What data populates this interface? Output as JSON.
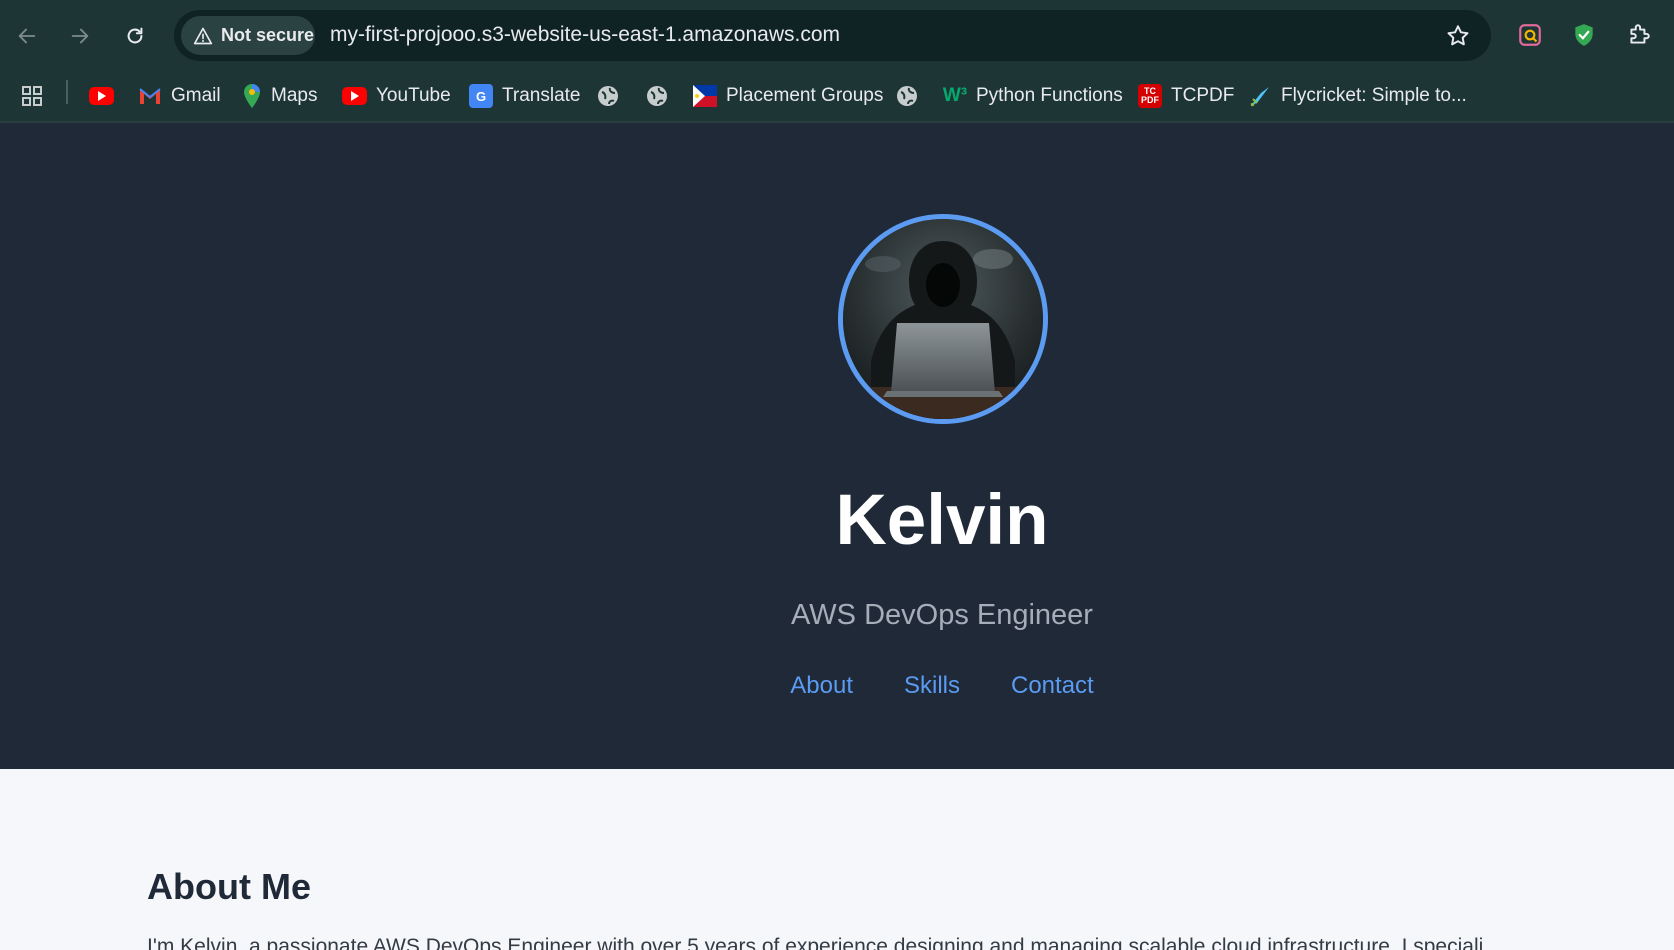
{
  "browser": {
    "security_label": "Not secure",
    "url": "my-first-projooo.s3-website-us-east-1.amazonaws.com",
    "bookmarks": [
      {
        "label": "",
        "icon": "youtube-icon"
      },
      {
        "label": "Gmail",
        "icon": "gmail-icon"
      },
      {
        "label": "Maps",
        "icon": "maps-icon"
      },
      {
        "label": "YouTube",
        "icon": "youtube-icon"
      },
      {
        "label": "Translate",
        "icon": "translate-icon"
      },
      {
        "label": "",
        "icon": "globe-icon"
      },
      {
        "label": "",
        "icon": "globe-icon"
      },
      {
        "label": "Placement Groups",
        "icon": "flag-icon"
      },
      {
        "label": "",
        "icon": "globe-icon"
      },
      {
        "label": "Python Functions",
        "icon": "w3schools-icon"
      },
      {
        "label": "TCPDF",
        "icon": "tcpdf-icon"
      },
      {
        "label": "Flycricket: Simple to...",
        "icon": "flycricket-icon"
      }
    ]
  },
  "profile": {
    "name": "Kelvin",
    "role": "AWS DevOps Engineer",
    "nav": [
      "About",
      "Skills",
      "Contact"
    ]
  },
  "about": {
    "heading": "About Me",
    "text": "I'm Kelvin, a passionate AWS DevOps Engineer with over 5 years of experience designing and managing scalable cloud infrastructure. I speciali"
  },
  "colors": {
    "hero_bg": "#1f2937",
    "accent": "#5b9bf2",
    "chrome_bg": "#1e3536"
  }
}
